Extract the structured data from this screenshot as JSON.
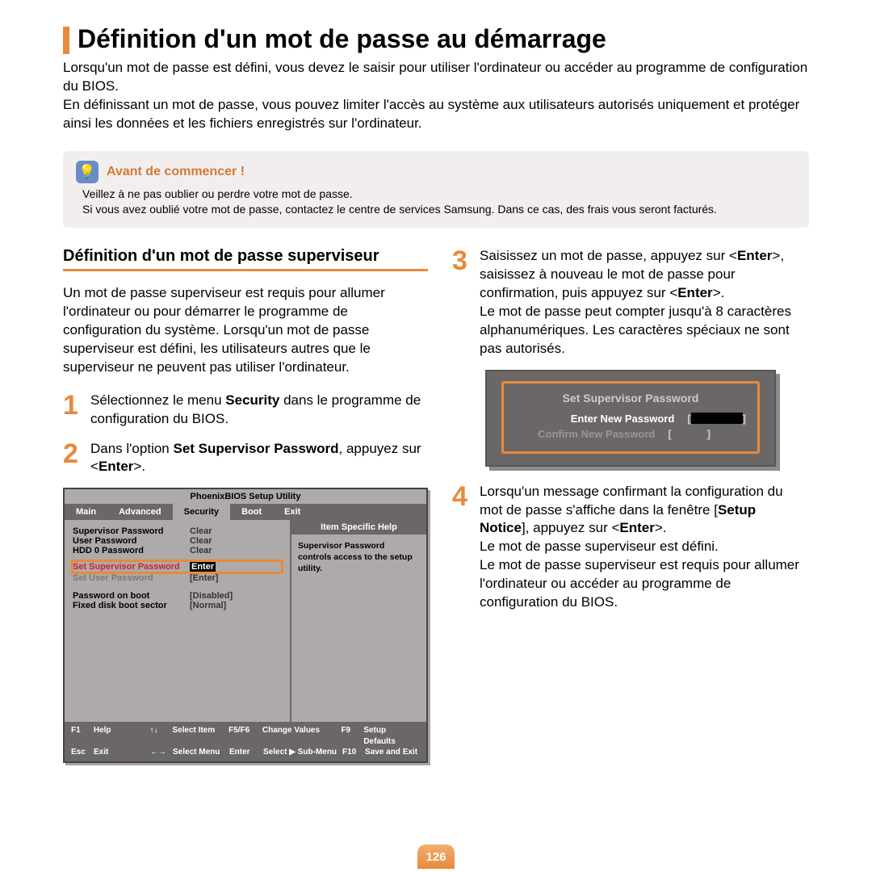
{
  "title": "Définition d'un mot de passe au démarrage",
  "intro": "Lorsqu'un mot de passe est défini, vous devez le saisir pour utiliser l'ordinateur ou accéder au programme de configuration du BIOS.\nEn définissant un mot de passe, vous pouvez limiter l'accès au système aux utilisateurs autorisés uniquement et protéger ainsi les données et les fichiers enregistrés sur l'ordinateur.",
  "note": {
    "title": "Avant de commencer !",
    "l1": "Veillez à ne pas oublier ou perdre votre mot de passe.",
    "l2": "Si vous avez oublié votre mot de passe, contactez le centre de services Samsung. Dans ce cas, des frais vous seront facturés."
  },
  "subheading": "Définition d'un mot de passe superviseur",
  "sub_desc": "Un mot de passe superviseur est requis pour allumer l'ordinateur ou pour démarrer le programme de configuration du système. Lorsqu'un mot de passe superviseur est défini, les utilisateurs autres que le superviseur ne peuvent pas utiliser l'ordinateur.",
  "step1": {
    "n": "1",
    "a": "Sélectionnez le menu ",
    "b": "Security",
    "c": " dans le programme de configuration du BIOS."
  },
  "step2": {
    "n": "2",
    "a": "Dans l'option ",
    "b": "Set Supervisor Password",
    "c": ", appuyez sur <",
    "d": "Enter",
    "e": ">."
  },
  "step3": {
    "n": "3",
    "a": "Saisissez un mot de passe, appuyez sur <",
    "b": "Enter",
    "c": ">, saisissez à nouveau le mot de passe pour confirmation, puis appuyez sur <",
    "d": "Enter",
    "e": ">.",
    "f": "Le mot de passe peut compter jusqu'à 8 caractères alphanumériques. Les caractères spéciaux ne sont pas autorisés."
  },
  "step4": {
    "n": "4",
    "a": "Lorsqu'un message confirmant la configuration du mot de passe s'affiche dans la fenêtre [",
    "b": "Setup Notice",
    "c": "], appuyez sur <",
    "d": "Enter",
    "e": ">.",
    "f": "Le mot de passe superviseur est défini.",
    "g": "Le mot de passe superviseur est requis pour allumer l'ordinateur ou accéder au programme de configuration du BIOS."
  },
  "bios": {
    "title": "PhoenixBIOS Setup Utility",
    "tabs": [
      "Main",
      "Advanced",
      "Security",
      "Boot",
      "Exit"
    ],
    "rows": [
      {
        "l": "Supervisor Password",
        "v": "Clear"
      },
      {
        "l": "User Password",
        "v": "Clear"
      },
      {
        "l": "HDD 0 Password",
        "v": "Clear"
      }
    ],
    "sel": {
      "l": "Set Supervisor Password",
      "v": "Enter"
    },
    "after": {
      "l": "Set User Password",
      "v": "[Enter]"
    },
    "rows2": [
      {
        "l": "Password on boot",
        "v": "[Disabled]",
        "dim": true
      },
      {
        "l": "Fixed disk boot sector",
        "v": "[Normal]"
      }
    ],
    "help_title": "Item Specific Help",
    "help_body": "Supervisor Password controls access to the setup utility.",
    "foot": {
      "r1": [
        {
          "k": "F1",
          "t": "Help"
        },
        {
          "k": "↑↓",
          "t": "Select Item"
        },
        {
          "k": "F5/F6",
          "t": "Change Values"
        },
        {
          "k": "F9",
          "t": "Setup Defaults"
        }
      ],
      "r2": [
        {
          "k": "Esc",
          "t": "Exit"
        },
        {
          "k": "←→",
          "t": "Select Menu"
        },
        {
          "k": "Enter",
          "t": "Select ▶ Sub-Menu"
        },
        {
          "k": "F10",
          "t": "Save and Exit"
        }
      ]
    }
  },
  "dlg": {
    "title": "Set Supervisor Password",
    "l1": "Enter New Password",
    "l2": "Confirm New Password",
    "br": "[         ]"
  },
  "page_num": "126"
}
